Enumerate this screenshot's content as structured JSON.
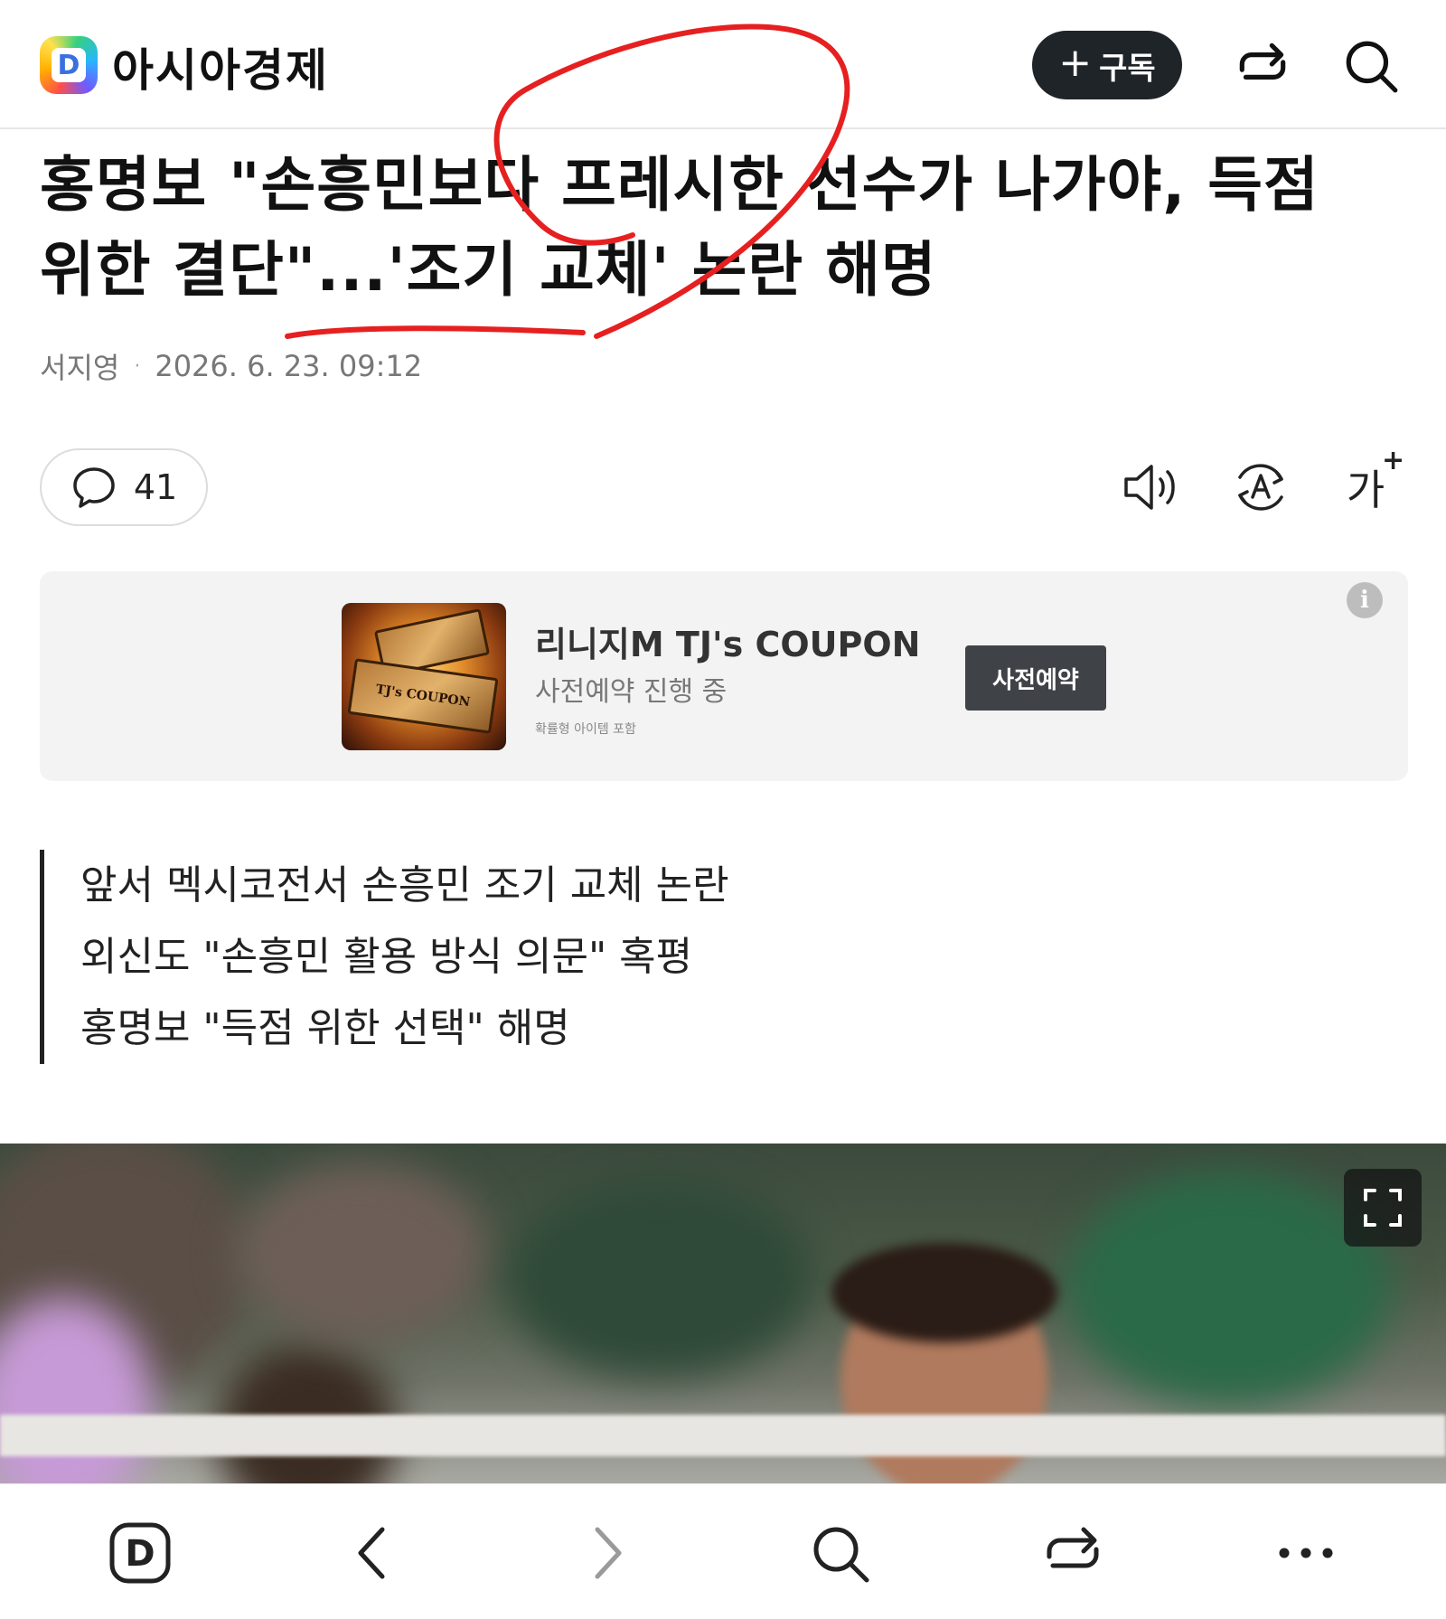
{
  "header": {
    "logo_letter": "D",
    "site_name": "아시아경제",
    "subscribe_plus": "+",
    "subscribe_label": "구독",
    "icons": [
      "share-icon",
      "search-icon"
    ]
  },
  "article": {
    "title": "홍명보 \"손흥민보다 프레시한 선수가 나가야, 득점 위한 결단\"...'조기 교체' 논란 해명",
    "author": "서지영",
    "separator": "·",
    "date": "2026. 6. 23. 09:12",
    "comment_count": "41"
  },
  "toolbar": {
    "icons": [
      "speaker-icon",
      "translate-icon",
      "font-size-icon"
    ],
    "font_size_label": "가",
    "font_size_plus": "+"
  },
  "ad": {
    "coupon_text": "TJ's COUPON",
    "title": "리니지M TJ's COUPON",
    "subtitle": "사전예약 진행 중",
    "note": "확률형 아이템 포함",
    "cta": "사전예약",
    "info": "i"
  },
  "summary": {
    "lines": [
      "앞서 멕시코전서 손흥민 조기 교체 논란",
      "외신도 \"손흥민 활용 방식 의문\" 혹평",
      "홍명보 \"득점 위한 선택\" 해명"
    ]
  },
  "bottom_nav": {
    "home_letter": "D",
    "icons": [
      "home-icon",
      "back-icon",
      "forward-icon",
      "search-icon",
      "share-icon",
      "more-icon"
    ]
  },
  "colors": {
    "annotation_red": "#e62020",
    "subscribe_bg": "#1f2429",
    "ad_bg": "#f3f3f3",
    "ad_cta_bg": "#3f4347"
  }
}
